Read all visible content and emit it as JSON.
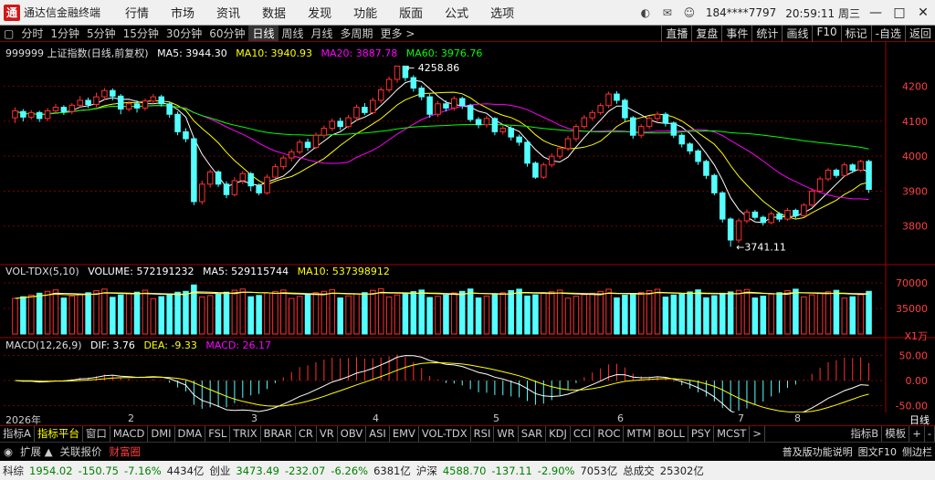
{
  "app": {
    "logo_char": "通",
    "title": "通达信金融终端"
  },
  "menu": [
    "行情",
    "市场",
    "资讯",
    "数据",
    "发现",
    "功能",
    "版面",
    "公式",
    "选项"
  ],
  "account": {
    "user_id": "184****7797",
    "time": "20:59:11 周三"
  },
  "periods": [
    "分时",
    "1分钟",
    "5分钟",
    "15分钟",
    "30分钟",
    "60分钟",
    "日线",
    "周线",
    "月线",
    "多周期",
    "更多 >"
  ],
  "active_period": "日线",
  "right_tools": [
    "直播",
    "复盘",
    "事件",
    "统计",
    "画线",
    "F10",
    "标记",
    "-自选",
    "返回"
  ],
  "price_legend": {
    "name": "999999 上证指数(日线,前复权)",
    "ma5": "MA5: 3944.30",
    "ma10": "MA10: 3940.93",
    "ma20": "MA20: 3887.78",
    "ma60": "MA60: 3976.76"
  },
  "volume_legend": {
    "name": "VOL-TDX(5,10)",
    "volume": "VOLUME: 572191232",
    "ma5": "MA5: 529115744",
    "ma10": "MA10: 537398912"
  },
  "macd_legend": {
    "name": "MACD(12,26,9)",
    "dif": "DIF: 3.76",
    "dea": "DEA: -9.33",
    "macd": "MACD: 26.17"
  },
  "annotations": {
    "high": "4258.86",
    "low": "3741.11"
  },
  "axis_price": [
    "4200",
    "4100",
    "4000",
    "3900",
    "3800"
  ],
  "axis_volume": [
    "70000",
    "35000",
    "X1万"
  ],
  "axis_macd": [
    "50.00",
    "0.00",
    "-50.00"
  ],
  "dates": [
    "2026年",
    "2",
    "3",
    "4",
    "5",
    "6",
    "7",
    "8"
  ],
  "date_right": "日线",
  "indicators": [
    "指标A",
    "指标平台",
    "窗口",
    "MACD",
    "DMI",
    "DMA",
    "FSL",
    "TRIX",
    "BRAR",
    "CR",
    "VR",
    "OBV",
    "ASI",
    "EMV",
    "VOL-TDX",
    "RSI",
    "WR",
    "SAR",
    "KDJ",
    "CCI",
    "ROC",
    "MTM",
    "BOLL",
    "PSY",
    "MCST",
    ">"
  ],
  "indicator_right": [
    "指标B",
    "模板",
    "+",
    "-"
  ],
  "sub_left": [
    "扩展 ▲",
    "关联报价",
    "财富圈"
  ],
  "sub_right": [
    "普及版功能说明",
    "图文F10",
    "侧边栏"
  ],
  "status": [
    {
      "t": "科综",
      "c": ""
    },
    {
      "t": "1954.02",
      "c": "g"
    },
    {
      "t": "-150.75",
      "c": "g"
    },
    {
      "t": "-7.16%",
      "c": "g"
    },
    {
      "t": "4434亿",
      "c": ""
    },
    {
      "t": "创业",
      "c": ""
    },
    {
      "t": "3473.49",
      "c": "g"
    },
    {
      "t": "-232.07",
      "c": "g"
    },
    {
      "t": "-6.26%",
      "c": "g"
    },
    {
      "t": "6381亿",
      "c": ""
    },
    {
      "t": "沪深",
      "c": ""
    },
    {
      "t": "4588.70",
      "c": "g"
    },
    {
      "t": "-137.11",
      "c": "g"
    },
    {
      "t": "-2.90%",
      "c": "g"
    },
    {
      "t": "7053亿",
      "c": ""
    },
    {
      "t": "总成交",
      "c": ""
    },
    {
      "t": "25302亿",
      "c": ""
    }
  ],
  "colors": {
    "up": "#ff3030",
    "down": "#54ffff",
    "ma5": "#ffffff",
    "ma10": "#ffff00",
    "ma20": "#ff00ff",
    "ma60": "#00ff00",
    "grid": "#7a0000"
  },
  "chart_data": {
    "type": "candlestick",
    "ylim": [
      3700,
      4280
    ],
    "candles": [
      [
        4110,
        4130,
        4095,
        4140
      ],
      [
        4128,
        4112,
        4100,
        4135
      ],
      [
        4112,
        4125,
        4105,
        4132
      ],
      [
        4125,
        4108,
        4098,
        4130
      ],
      [
        4108,
        4130,
        4100,
        4138
      ],
      [
        4130,
        4140,
        4122,
        4150
      ],
      [
        4140,
        4128,
        4118,
        4146
      ],
      [
        4128,
        4146,
        4120,
        4152
      ],
      [
        4146,
        4160,
        4140,
        4172
      ],
      [
        4160,
        4148,
        4138,
        4168
      ],
      [
        4148,
        4170,
        4140,
        4182
      ],
      [
        4170,
        4188,
        4160,
        4195
      ],
      [
        4188,
        4172,
        4160,
        4194
      ],
      [
        4172,
        4135,
        4120,
        4178
      ],
      [
        4135,
        4150,
        4128,
        4158
      ],
      [
        4150,
        4138,
        4125,
        4160
      ],
      [
        4138,
        4158,
        4130,
        4165
      ],
      [
        4158,
        4170,
        4150,
        4178
      ],
      [
        4170,
        4150,
        4142,
        4176
      ],
      [
        4150,
        4120,
        4110,
        4155
      ],
      [
        4120,
        4070,
        4060,
        4128
      ],
      [
        4070,
        4050,
        4040,
        4080
      ],
      [
        4050,
        3870,
        3860,
        4055
      ],
      [
        3870,
        3920,
        3862,
        3930
      ],
      [
        3920,
        3955,
        3910,
        3962
      ],
      [
        3955,
        3920,
        3912,
        3960
      ],
      [
        3920,
        3890,
        3880,
        3928
      ],
      [
        3890,
        3930,
        3885,
        3940
      ],
      [
        3930,
        3950,
        3920,
        3958
      ],
      [
        3950,
        3915,
        3900,
        3955
      ],
      [
        3915,
        3895,
        3888,
        3922
      ],
      [
        3895,
        3940,
        3890,
        3948
      ],
      [
        3940,
        3970,
        3935,
        3978
      ],
      [
        3970,
        3995,
        3962,
        4002
      ],
      [
        3995,
        4012,
        3985,
        4020
      ],
      [
        4012,
        4040,
        4005,
        4048
      ],
      [
        4040,
        4025,
        4015,
        4050
      ],
      [
        4025,
        4060,
        4020,
        4068
      ],
      [
        4060,
        4080,
        4052,
        4088
      ],
      [
        4080,
        4100,
        4072,
        4108
      ],
      [
        4100,
        4085,
        4075,
        4110
      ],
      [
        4085,
        4110,
        4080,
        4118
      ],
      [
        4110,
        4140,
        4102,
        4148
      ],
      [
        4140,
        4125,
        4118,
        4152
      ],
      [
        4125,
        4160,
        4120,
        4168
      ],
      [
        4160,
        4190,
        4152,
        4198
      ],
      [
        4190,
        4220,
        4182,
        4228
      ],
      [
        4220,
        4258,
        4210,
        4259
      ],
      [
        4258,
        4225,
        4215,
        4259
      ],
      [
        4225,
        4195,
        4185,
        4232
      ],
      [
        4195,
        4170,
        4160,
        4202
      ],
      [
        4170,
        4120,
        4110,
        4178
      ],
      [
        4120,
        4150,
        4112,
        4158
      ],
      [
        4150,
        4138,
        4128,
        4160
      ],
      [
        4138,
        4165,
        4130,
        4172
      ],
      [
        4165,
        4145,
        4135,
        4170
      ],
      [
        4145,
        4105,
        4098,
        4150
      ],
      [
        4105,
        4090,
        4080,
        4112
      ],
      [
        4090,
        4108,
        4082,
        4116
      ],
      [
        4108,
        4070,
        4060,
        4112
      ],
      [
        4070,
        4080,
        4062,
        4088
      ],
      [
        4080,
        4055,
        4045,
        4086
      ],
      [
        4055,
        4040,
        4030,
        4062
      ],
      [
        4040,
        3980,
        3970,
        4045
      ],
      [
        3980,
        3940,
        3935,
        3985
      ],
      [
        3940,
        3975,
        3935,
        3982
      ],
      [
        3975,
        4000,
        3968,
        4008
      ],
      [
        4000,
        4022,
        3992,
        4030
      ],
      [
        4022,
        4050,
        4015,
        4058
      ],
      [
        4050,
        4085,
        4042,
        4092
      ],
      [
        4085,
        4110,
        4078,
        4118
      ],
      [
        4110,
        4125,
        4102,
        4132
      ],
      [
        4125,
        4145,
        4118,
        4152
      ],
      [
        4145,
        4178,
        4138,
        4185
      ],
      [
        4178,
        4160,
        4150,
        4186
      ],
      [
        4160,
        4110,
        4100,
        4165
      ],
      [
        4110,
        4060,
        4050,
        4115
      ],
      [
        4060,
        4085,
        4052,
        4092
      ],
      [
        4085,
        4108,
        4078,
        4115
      ],
      [
        4108,
        4120,
        4100,
        4128
      ],
      [
        4120,
        4095,
        4085,
        4126
      ],
      [
        4095,
        4060,
        4052,
        4100
      ],
      [
        4060,
        4035,
        4025,
        4066
      ],
      [
        4035,
        4015,
        4005,
        4040
      ],
      [
        4015,
        3985,
        3975,
        4020
      ],
      [
        3985,
        3945,
        3935,
        3990
      ],
      [
        3945,
        3895,
        3888,
        3950
      ],
      [
        3895,
        3820,
        3810,
        3900
      ],
      [
        3820,
        3760,
        3741,
        3825
      ],
      [
        3760,
        3815,
        3752,
        3822
      ],
      [
        3815,
        3840,
        3808,
        3848
      ],
      [
        3840,
        3825,
        3818,
        3846
      ],
      [
        3825,
        3810,
        3802,
        3830
      ],
      [
        3810,
        3835,
        3805,
        3842
      ],
      [
        3835,
        3820,
        3812,
        3840
      ],
      [
        3820,
        3845,
        3815,
        3852
      ],
      [
        3845,
        3830,
        3822,
        3850
      ],
      [
        3830,
        3860,
        3825,
        3866
      ],
      [
        3860,
        3900,
        3855,
        3908
      ],
      [
        3900,
        3935,
        3895,
        3942
      ],
      [
        3935,
        3960,
        3928,
        3966
      ],
      [
        3960,
        3945,
        3938,
        3965
      ],
      [
        3945,
        3975,
        3940,
        3982
      ],
      [
        3975,
        3960,
        3952,
        3980
      ],
      [
        3960,
        3985,
        3955,
        3990
      ],
      [
        3985,
        3905,
        3895,
        3990
      ]
    ],
    "volume_ylim": [
      0,
      80000
    ],
    "macd_ylim": [
      -60,
      60
    ]
  }
}
